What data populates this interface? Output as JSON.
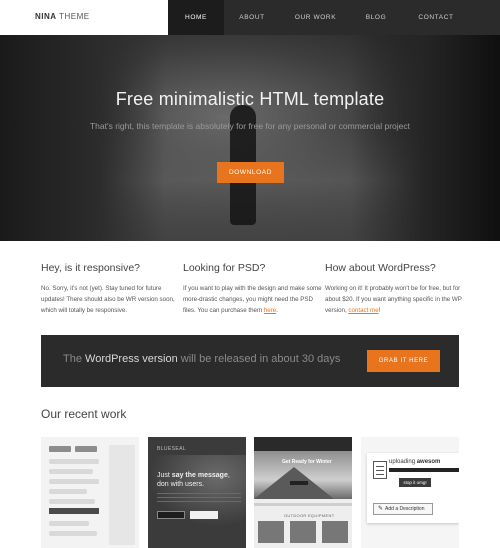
{
  "brand": {
    "bold": "NINA",
    "light": "THEME"
  },
  "nav": [
    "HOME",
    "ABOUT",
    "OUR WORK",
    "BLOG",
    "CONTACT"
  ],
  "hero": {
    "title": "Free minimalistic HTML template",
    "subtitle": "That's right, this template is absolutely for free for any personal or commercial project",
    "button": "DOWNLOAD"
  },
  "features": [
    {
      "title": "Hey, is it responsive?",
      "text": "No. Sorry, it's not (yet). Stay tuned for future updates! There should also be WR version soon, which will totally be responsive.",
      "link": "",
      "after": ""
    },
    {
      "title": "Looking for PSD?",
      "text": "If you want to play with the design and make some more-drastic changes, you might need the PSD files. You can purchase them ",
      "link": "here",
      "after": "."
    },
    {
      "title": "How about WordPress?",
      "text": "Working on it! It probably won't be for free, but for about $20. If you want anything specific in the WP version, ",
      "link": "contact me",
      "after": "!"
    }
  ],
  "banner": {
    "before": "The ",
    "highlight": "WordPress version",
    "after": " will be released in about 30 days",
    "button": "GRAB IT HERE"
  },
  "recent_work": {
    "title": "Our recent work",
    "thumbs": [
      {
        "name": "ui-kit"
      },
      {
        "name": "blueseal",
        "header": "BLUESEAL",
        "headline_pre": "Just ",
        "headline_bold": "say the message",
        "headline_post": ", don with users."
      },
      {
        "name": "ready-for-winter",
        "caption": "Get Ready for Winter",
        "label": "OUTDOOR EQUIPMENT"
      },
      {
        "name": "uploader",
        "uploading": "uploading ",
        "uploading_bold": "awesom",
        "stop": "stop it omg!",
        "description": "Add a Description"
      }
    ]
  },
  "colors": {
    "accent": "#e8741e",
    "dark": "#2b2b2b"
  }
}
